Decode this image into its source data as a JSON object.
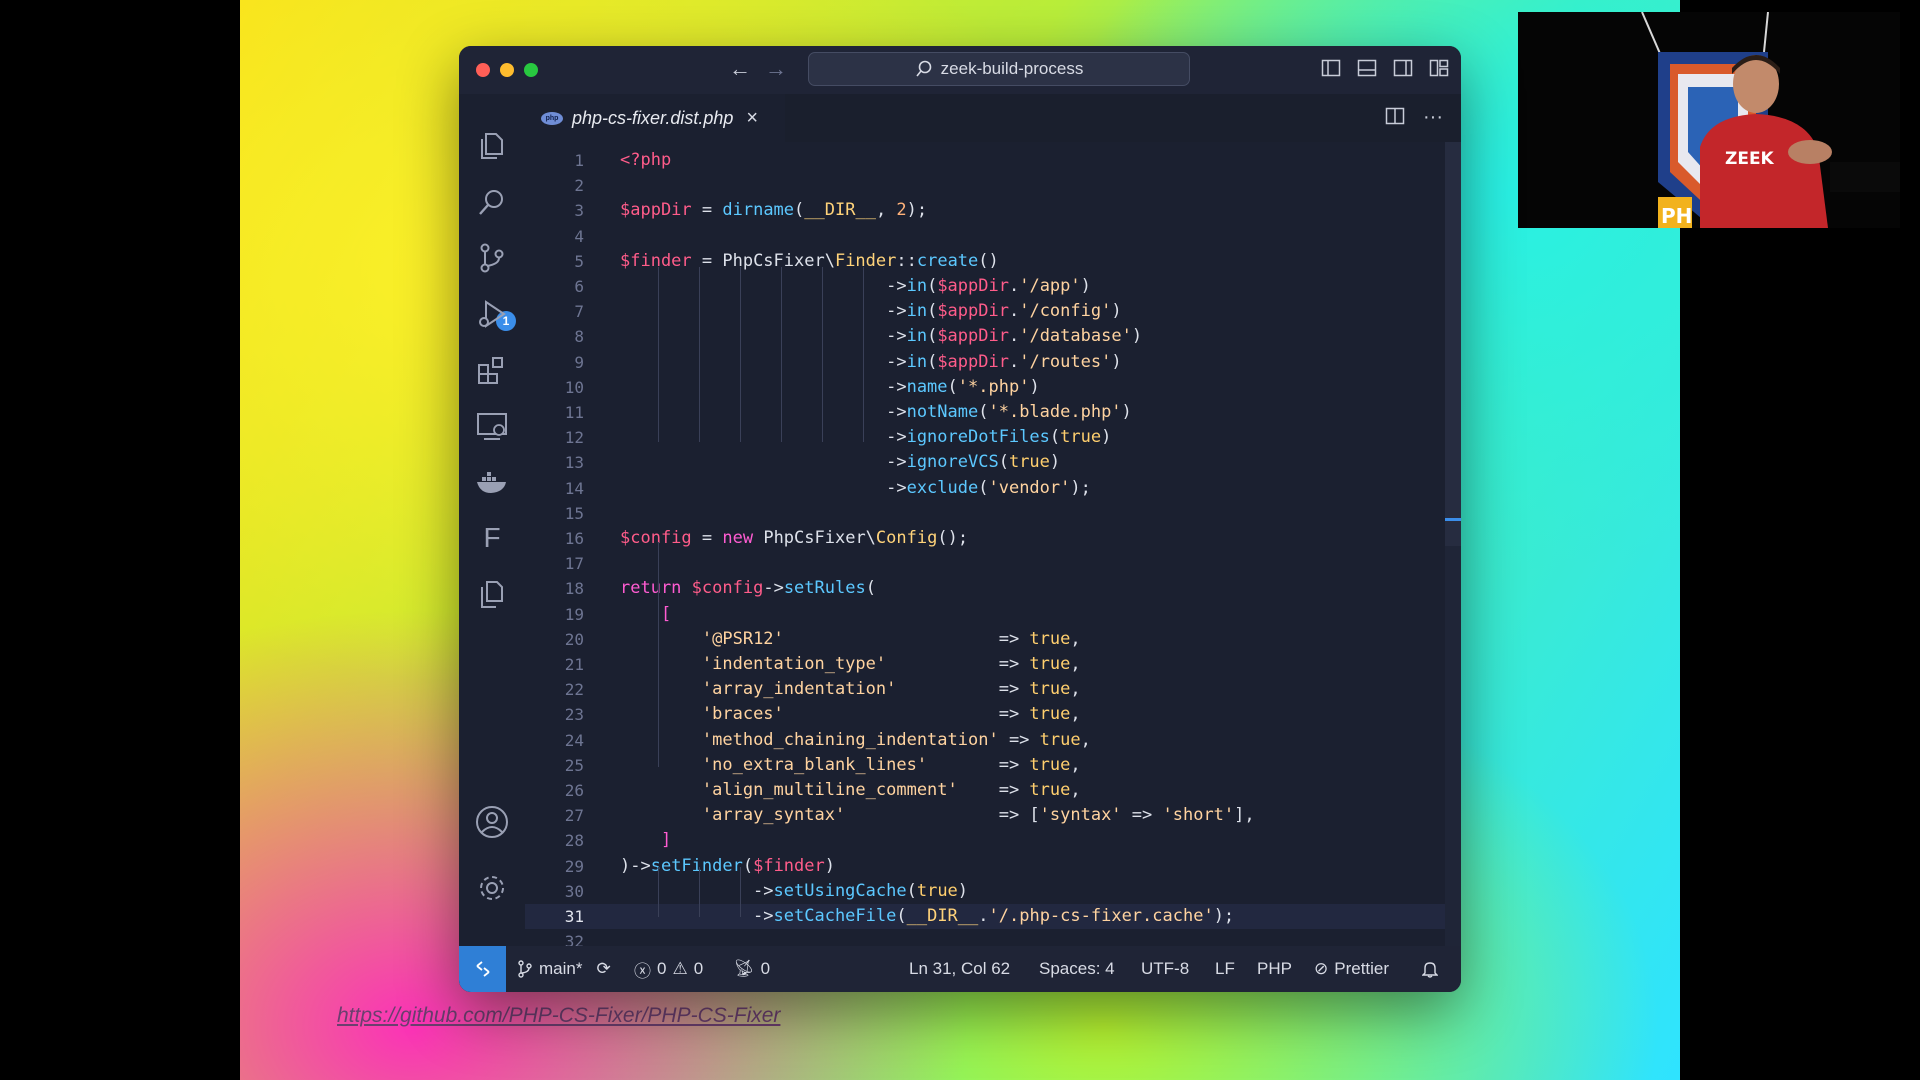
{
  "window": {
    "search_text": "zeek-build-process",
    "tab_label": "php-cs-fixer.dist.php",
    "tab_close": "×",
    "tab_actions_more": "···"
  },
  "activity_bar": {
    "source_control_badge": "1",
    "f_letter": "F"
  },
  "editor": {
    "current_line": 31,
    "lines": [
      [
        [
          "k-key",
          "<?php"
        ]
      ],
      [],
      [
        [
          "k-var",
          "$appDir"
        ],
        [
          "k-punc",
          " = "
        ],
        [
          "k-fn",
          "dirname"
        ],
        [
          "k-punc",
          "("
        ],
        [
          "k-cls",
          "__DIR__"
        ],
        [
          "k-punc",
          ", "
        ],
        [
          "k-num",
          "2"
        ],
        [
          "k-punc",
          ");"
        ]
      ],
      [],
      [
        [
          "k-var",
          "$finder"
        ],
        [
          "k-punc",
          " = PhpCsFixer\\"
        ],
        [
          "k-cls",
          "Finder"
        ],
        [
          "k-punc",
          "::"
        ],
        [
          "k-fn",
          "create"
        ],
        [
          "k-punc",
          "()"
        ]
      ],
      [
        [
          "k-punc",
          "                          ->"
        ],
        [
          "k-fn",
          "in"
        ],
        [
          "k-punc",
          "("
        ],
        [
          "k-var",
          "$appDir"
        ],
        [
          "k-punc",
          "."
        ],
        [
          "k-str",
          "'/app'"
        ],
        [
          "k-punc",
          ")"
        ]
      ],
      [
        [
          "k-punc",
          "                          ->"
        ],
        [
          "k-fn",
          "in"
        ],
        [
          "k-punc",
          "("
        ],
        [
          "k-var",
          "$appDir"
        ],
        [
          "k-punc",
          "."
        ],
        [
          "k-str",
          "'/config'"
        ],
        [
          "k-punc",
          ")"
        ]
      ],
      [
        [
          "k-punc",
          "                          ->"
        ],
        [
          "k-fn",
          "in"
        ],
        [
          "k-punc",
          "("
        ],
        [
          "k-var",
          "$appDir"
        ],
        [
          "k-punc",
          "."
        ],
        [
          "k-str",
          "'/database'"
        ],
        [
          "k-punc",
          ")"
        ]
      ],
      [
        [
          "k-punc",
          "                          ->"
        ],
        [
          "k-fn",
          "in"
        ],
        [
          "k-punc",
          "("
        ],
        [
          "k-var",
          "$appDir"
        ],
        [
          "k-punc",
          "."
        ],
        [
          "k-str",
          "'/routes'"
        ],
        [
          "k-punc",
          ")"
        ]
      ],
      [
        [
          "k-punc",
          "                          ->"
        ],
        [
          "k-fn",
          "name"
        ],
        [
          "k-punc",
          "("
        ],
        [
          "k-str",
          "'*.php'"
        ],
        [
          "k-punc",
          ")"
        ]
      ],
      [
        [
          "k-punc",
          "                          ->"
        ],
        [
          "k-fn",
          "notName"
        ],
        [
          "k-punc",
          "("
        ],
        [
          "k-str",
          "'*.blade.php'"
        ],
        [
          "k-punc",
          ")"
        ]
      ],
      [
        [
          "k-punc",
          "                          ->"
        ],
        [
          "k-fn",
          "ignoreDotFiles"
        ],
        [
          "k-punc",
          "("
        ],
        [
          "k-bool",
          "true"
        ],
        [
          "k-punc",
          ")"
        ]
      ],
      [
        [
          "k-punc",
          "                          ->"
        ],
        [
          "k-fn",
          "ignoreVCS"
        ],
        [
          "k-punc",
          "("
        ],
        [
          "k-bool",
          "true"
        ],
        [
          "k-punc",
          ")"
        ]
      ],
      [
        [
          "k-punc",
          "                          ->"
        ],
        [
          "k-fn",
          "exclude"
        ],
        [
          "k-punc",
          "("
        ],
        [
          "k-str",
          "'vendor'"
        ],
        [
          "k-punc",
          ");"
        ]
      ],
      [],
      [
        [
          "k-var",
          "$config"
        ],
        [
          "k-punc",
          " = "
        ],
        [
          "k-kw",
          "new"
        ],
        [
          "k-punc",
          " PhpCsFixer\\"
        ],
        [
          "k-cls",
          "Config"
        ],
        [
          "k-punc",
          "();"
        ]
      ],
      [],
      [
        [
          "k-kw",
          "return"
        ],
        [
          "k-punc",
          " "
        ],
        [
          "k-var",
          "$config"
        ],
        [
          "k-punc",
          "->"
        ],
        [
          "k-fn",
          "setRules"
        ],
        [
          "k-punc",
          "("
        ]
      ],
      [
        [
          "k-punc",
          "    "
        ],
        [
          "k-br",
          "["
        ]
      ],
      [
        [
          "k-punc",
          "        "
        ],
        [
          "k-str",
          "'@PSR12'"
        ],
        [
          "k-punc",
          "                     => "
        ],
        [
          "k-bool",
          "true"
        ],
        [
          "k-punc",
          ","
        ]
      ],
      [
        [
          "k-punc",
          "        "
        ],
        [
          "k-str",
          "'indentation_type'"
        ],
        [
          "k-punc",
          "           => "
        ],
        [
          "k-bool",
          "true"
        ],
        [
          "k-punc",
          ","
        ]
      ],
      [
        [
          "k-punc",
          "        "
        ],
        [
          "k-str",
          "'array_indentation'"
        ],
        [
          "k-punc",
          "          => "
        ],
        [
          "k-bool",
          "true"
        ],
        [
          "k-punc",
          ","
        ]
      ],
      [
        [
          "k-punc",
          "        "
        ],
        [
          "k-str",
          "'braces'"
        ],
        [
          "k-punc",
          "                     => "
        ],
        [
          "k-bool",
          "true"
        ],
        [
          "k-punc",
          ","
        ]
      ],
      [
        [
          "k-punc",
          "        "
        ],
        [
          "k-str",
          "'method_chaining_indentation'"
        ],
        [
          "k-punc",
          " => "
        ],
        [
          "k-bool",
          "true"
        ],
        [
          "k-punc",
          ","
        ]
      ],
      [
        [
          "k-punc",
          "        "
        ],
        [
          "k-str",
          "'no_extra_blank_lines'"
        ],
        [
          "k-punc",
          "       => "
        ],
        [
          "k-bool",
          "true"
        ],
        [
          "k-punc",
          ","
        ]
      ],
      [
        [
          "k-punc",
          "        "
        ],
        [
          "k-str",
          "'align_multiline_comment'"
        ],
        [
          "k-punc",
          "    => "
        ],
        [
          "k-bool",
          "true"
        ],
        [
          "k-punc",
          ","
        ]
      ],
      [
        [
          "k-punc",
          "        "
        ],
        [
          "k-str",
          "'array_syntax'"
        ],
        [
          "k-punc",
          "               => ["
        ],
        [
          "k-str",
          "'syntax'"
        ],
        [
          "k-punc",
          " => "
        ],
        [
          "k-str",
          "'short'"
        ],
        [
          "k-punc",
          "],"
        ]
      ],
      [
        [
          "k-punc",
          "    "
        ],
        [
          "k-br",
          "]"
        ]
      ],
      [
        [
          "k-punc",
          ")->"
        ],
        [
          "k-fn",
          "setFinder"
        ],
        [
          "k-punc",
          "("
        ],
        [
          "k-var",
          "$finder"
        ],
        [
          "k-punc",
          ")"
        ]
      ],
      [
        [
          "k-punc",
          "             ->"
        ],
        [
          "k-fn",
          "setUsingCache"
        ],
        [
          "k-punc",
          "("
        ],
        [
          "k-bool",
          "true"
        ],
        [
          "k-punc",
          ")"
        ]
      ],
      [
        [
          "k-punc",
          "             ->"
        ],
        [
          "k-fn",
          "setCacheFile"
        ],
        [
          "k-punc",
          "("
        ],
        [
          "k-cls",
          "__DIR__"
        ],
        [
          "k-punc",
          "."
        ],
        [
          "k-str",
          "'/.php-cs-fixer.cache'"
        ],
        [
          "k-punc",
          ");"
        ]
      ],
      []
    ]
  },
  "status_bar": {
    "branch": "main*",
    "errors": "0",
    "warnings": "0",
    "ports": "0",
    "position": "Ln 31, Col 62",
    "spaces": "Spaces: 4",
    "encoding": "UTF-8",
    "eol": "LF",
    "language": "PHP",
    "formatter": "Prettier"
  },
  "source_link": "https://github.com/PHP-CS-Fixer/PHP-CS-Fixer",
  "webcam": {
    "shirt_text": "ZEEK",
    "banner_text": "PH"
  },
  "colors": {
    "editor_bg": "#1b2030",
    "accent_blue": "#2f7fd6",
    "keyword_pink": "#ff5cd2",
    "function_cyan": "#5cc8ff",
    "string_peach": "#ffd3a0"
  }
}
